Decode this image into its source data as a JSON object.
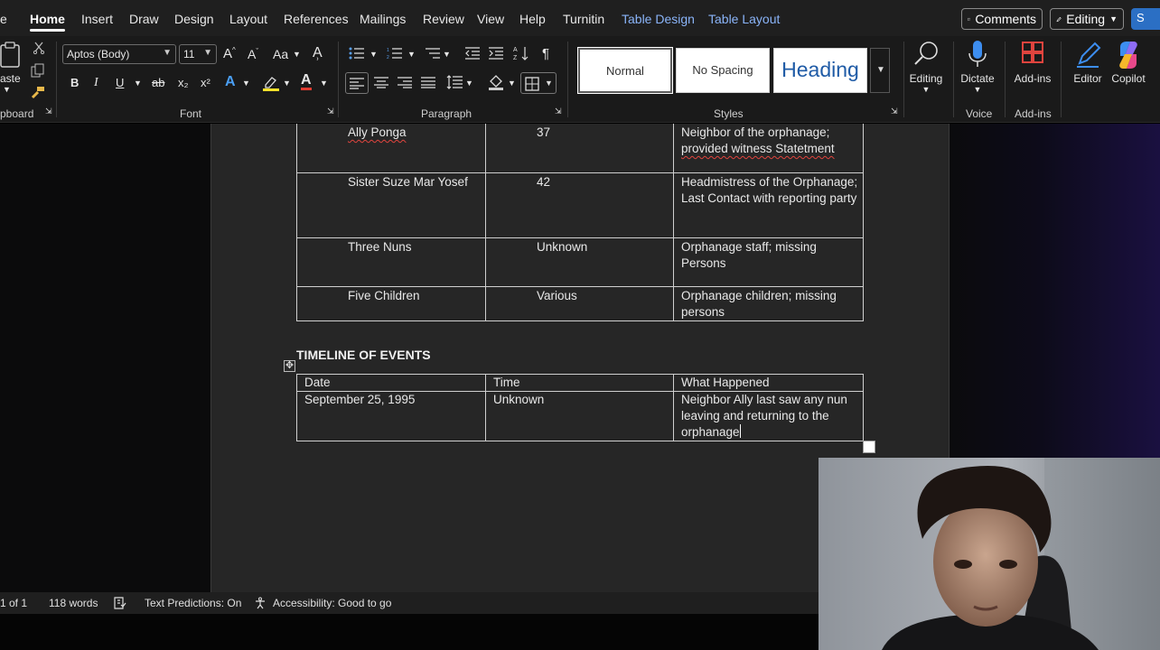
{
  "menu": {
    "file_fragment": "e",
    "tabs": [
      "Home",
      "Insert",
      "Draw",
      "Design",
      "Layout",
      "References",
      "Mailings",
      "Review",
      "View",
      "Help",
      "Turnitin"
    ],
    "context_tabs": [
      "Table Design",
      "Table Layout"
    ],
    "comments_label": "Comments",
    "editing_label": "Editing",
    "share_fragment": "S"
  },
  "ribbon": {
    "clipboard": {
      "paste_fragment": "aste",
      "group_label": "pboard"
    },
    "font": {
      "name": "Aptos (Body)",
      "size": "11",
      "group_label": "Font",
      "bold": "B",
      "italic": "I",
      "underline": "U",
      "strike": "ab",
      "subscript": "x₂",
      "superscript": "x²",
      "grow": "A^",
      "shrink": "A˅",
      "case": "Aa"
    },
    "paragraph": {
      "group_label": "Paragraph",
      "pilcrow": "¶"
    },
    "styles": {
      "group_label": "Styles",
      "items": [
        "Normal",
        "No Spacing",
        "Heading"
      ]
    },
    "editing": {
      "label": "Editing"
    },
    "voice": {
      "label": "Dictate",
      "group_label": "Voice"
    },
    "addins": {
      "label": "Add-ins",
      "group_label": "Add-ins"
    },
    "editor": {
      "label": "Editor"
    },
    "copilot": {
      "label": "Copilot"
    }
  },
  "document": {
    "people_rows": [
      {
        "name": "Ally Ponga",
        "age": "37",
        "desc1": "Neighbor of the orphanage;",
        "desc2": "provided witness Statetment"
      },
      {
        "name": "Sister Suze Mar Yosef",
        "age": "42",
        "desc": "Headmistress of the Orphanage; Last Contact with reporting party"
      },
      {
        "name": "Three Nuns",
        "age": "Unknown",
        "desc": "Orphanage staff; missing Persons"
      },
      {
        "name": "Five Children",
        "age": "Various",
        "desc": "Orphanage children; missing persons"
      }
    ],
    "timeline_title": "TIMELINE OF EVENTS",
    "timeline_headers": [
      "Date",
      "Time",
      "What Happened"
    ],
    "timeline_rows": [
      {
        "date": "September 25, 1995",
        "time": "Unknown",
        "what": "Neighbor Ally last saw any nun leaving and returning to the orphanage"
      }
    ]
  },
  "status": {
    "page": "1 of 1",
    "words": "118 words",
    "predictions": "Text Predictions: On",
    "accessibility": "Accessibility: Good to go"
  },
  "colors": {
    "accent": "#2b6fc4",
    "context_tab": "#8ab4f8",
    "spell_error": "#e0443e"
  }
}
